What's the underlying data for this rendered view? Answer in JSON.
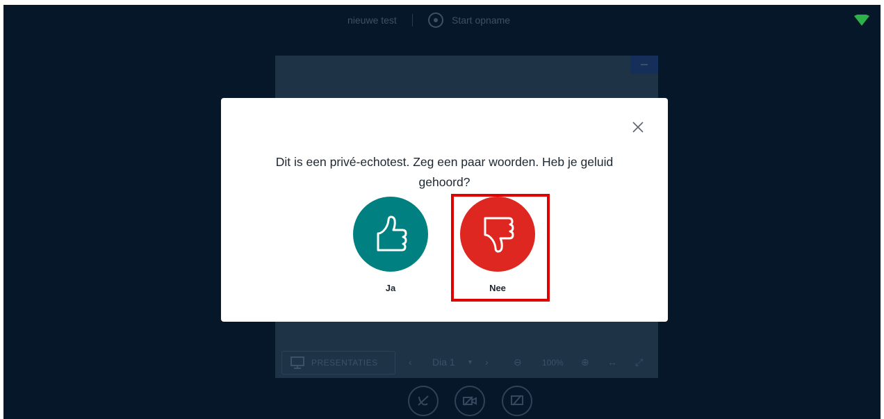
{
  "topbar": {
    "meeting_title": "nieuwe test",
    "record_label": "Start opname"
  },
  "presentation": {
    "presentations_button": "PRESENTATIES",
    "slide_label": "Dia 1",
    "zoom_level": "100%"
  },
  "modal": {
    "message": "Dit is een privé-echotest. Zeg een paar woorden. Heb je geluid gehoord?",
    "yes_label": "Ja",
    "no_label": "Nee"
  },
  "colors": {
    "background": "#06172A",
    "yes": "#008081",
    "no": "#DE2721",
    "highlight": "#E00000",
    "signal": "#2DB24A"
  },
  "icons": {
    "close": "close-icon",
    "yes": "thumbs-up-icon",
    "no": "thumbs-down-icon",
    "record": "record-icon",
    "signal": "connection-signal-icon"
  }
}
